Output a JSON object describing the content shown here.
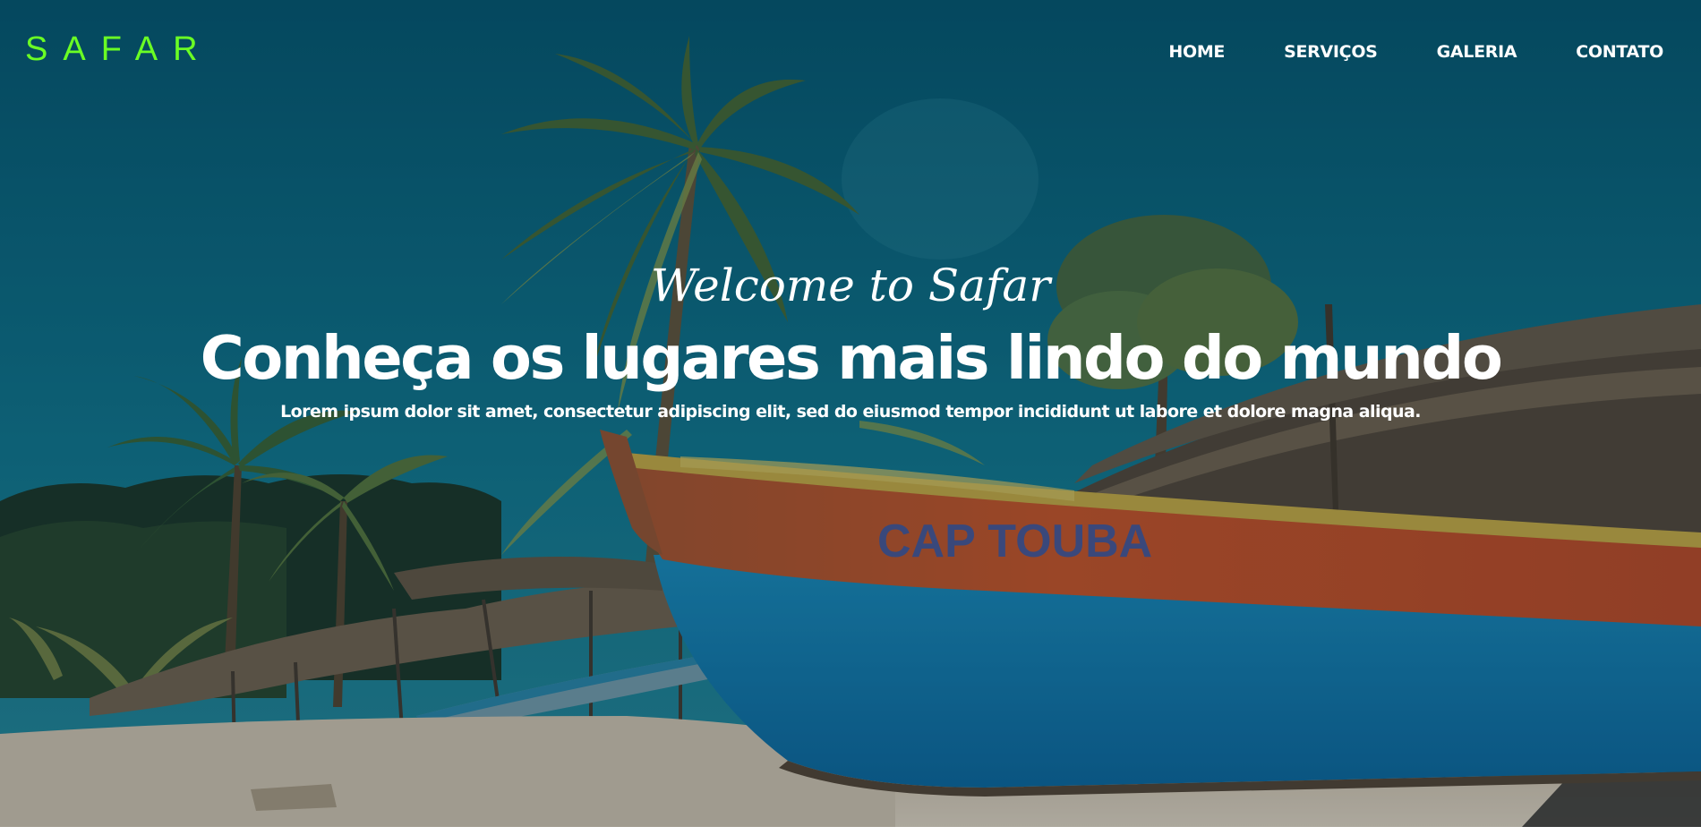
{
  "brand": {
    "logo_text": "SAFAR",
    "logo_color": "#6bff24"
  },
  "nav": {
    "items": [
      {
        "label": "HOME"
      },
      {
        "label": "SERVIÇOS"
      },
      {
        "label": "GALERIA"
      },
      {
        "label": "CONTATO"
      }
    ]
  },
  "hero": {
    "welcome": "Welcome to Safar",
    "headline": "Conheça os lugares mais lindo do mundo",
    "tagline": "Lorem ipsum dolor sit amet, consectetur adipiscing elit, sed do eiusmod tempor incididunt ut labore et dolore magna aliqua.",
    "boat_text": "CAP TOUBA",
    "colors": {
      "sky": "#0e6e86",
      "boat_hull": "#1b8fc4",
      "boat_stripe": "#d25a2a",
      "sand": "#e8d9c4"
    }
  }
}
